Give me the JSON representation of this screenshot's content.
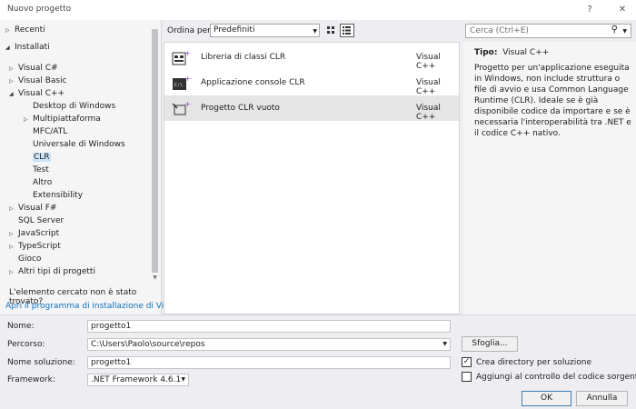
{
  "window": {
    "title": "Nuovo progetto",
    "help_label": "?",
    "close_label": "✕"
  },
  "tree": {
    "recent": "Recenti",
    "installed": "Installati",
    "items": [
      {
        "label": "Visual C#",
        "arrow": "▷"
      },
      {
        "label": "Visual Basic",
        "arrow": "▷"
      },
      {
        "label": "Visual C++",
        "arrow": "◢"
      },
      {
        "label": "Desktop di Windows",
        "arrow": ""
      },
      {
        "label": "Multipiattaforma",
        "arrow": "▷"
      },
      {
        "label": "MFC/ATL",
        "arrow": ""
      },
      {
        "label": "Universale di Windows",
        "arrow": ""
      },
      {
        "label": "CLR",
        "arrow": ""
      },
      {
        "label": "Test",
        "arrow": ""
      },
      {
        "label": "Altro",
        "arrow": ""
      },
      {
        "label": "Extensibility",
        "arrow": ""
      },
      {
        "label": "Visual F#",
        "arrow": "▷"
      },
      {
        "label": "SQL Server",
        "arrow": ""
      },
      {
        "label": "JavaScript",
        "arrow": "▷"
      },
      {
        "label": "TypeScript",
        "arrow": "▷"
      },
      {
        "label": "Gioco",
        "arrow": ""
      },
      {
        "label": "Altri tipi di progetti",
        "arrow": "▷"
      }
    ],
    "not_found": "L'elemento cercato non è stato trovato?",
    "installer_link": "Apri il programma di installazione di Visu..."
  },
  "sort": {
    "label": "Ordina per:",
    "value": "Predefiniti"
  },
  "search": {
    "placeholder": "Cerca (Ctrl+E)"
  },
  "templates": [
    {
      "name": "Libreria di classi CLR",
      "lang": "Visual C++",
      "icon": "class-library-icon"
    },
    {
      "name": "Applicazione console CLR",
      "lang": "Visual C++",
      "icon": "console-app-icon"
    },
    {
      "name": "Progetto CLR vuoto",
      "lang": "Visual C++",
      "icon": "empty-project-icon"
    }
  ],
  "details": {
    "type_label": "Tipo:",
    "type_value": "Visual C++",
    "description": "Progetto per un'applicazione eseguita in Windows, non include struttura o file di avvio e usa Common Language Runtime (CLR). Ideale se è già disponibile codice da importare e se è necessaria l'interoperabilità tra .NET e il codice C++ nativo."
  },
  "form": {
    "name_label": "Nome:",
    "name_value": "progetto1",
    "location_label": "Percorso:",
    "location_value": "C:\\Users\\Paolo\\source\\repos",
    "solution_label": "Nome soluzione:",
    "solution_value": "progetto1",
    "framework_label": "Framework:",
    "framework_value": ".NET Framework 4.6.1",
    "browse_label": "Sfoglia...",
    "create_dir_label": "Crea directory per soluzione",
    "create_dir_checked": true,
    "source_control_label": "Aggiungi al controllo del codice sorgente",
    "source_control_checked": false,
    "ok_label": "OK",
    "cancel_label": "Annulla"
  },
  "colors": {
    "accent": "#0e70c0",
    "selection": "#cce4f7",
    "plus": "#8a3fd1"
  }
}
